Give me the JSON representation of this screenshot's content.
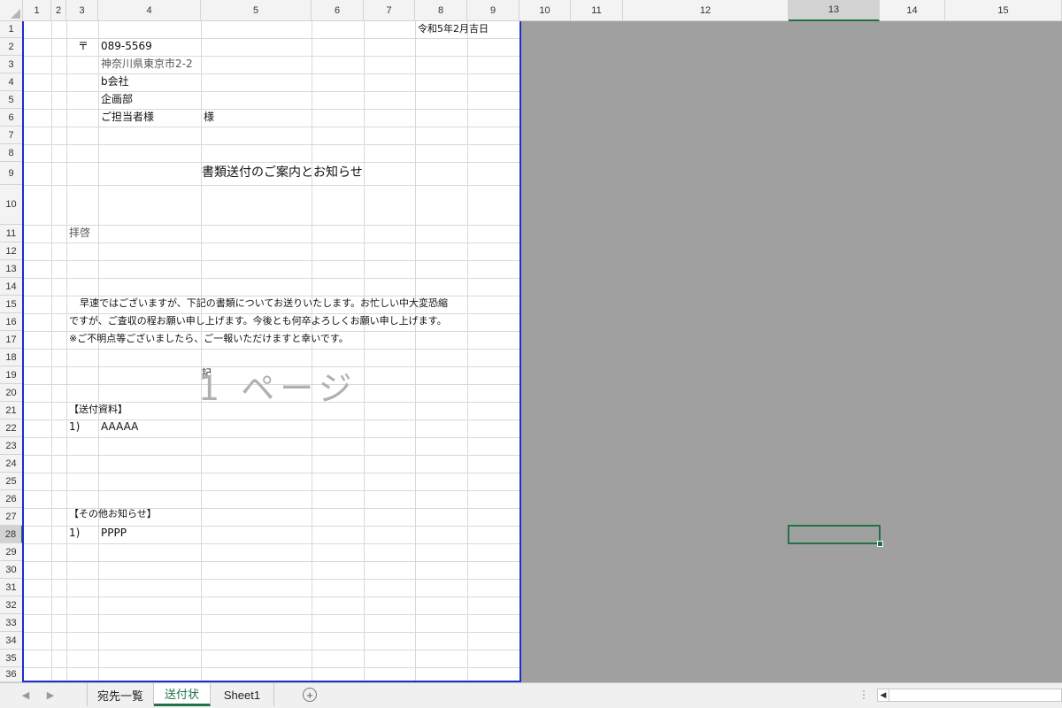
{
  "columns": [
    "1",
    "2",
    "3",
    "4",
    "5",
    "6",
    "7",
    "8",
    "9",
    "10",
    "11",
    "12",
    "13",
    "14",
    "15"
  ],
  "rows": [
    "1",
    "2",
    "3",
    "4",
    "5",
    "6",
    "7",
    "8",
    "9",
    "10",
    "11",
    "12",
    "13",
    "14",
    "15",
    "16",
    "17",
    "18",
    "19",
    "20",
    "21",
    "22",
    "23",
    "24",
    "25",
    "26",
    "27",
    "28",
    "29",
    "30",
    "31",
    "32",
    "33",
    "34",
    "35",
    "36"
  ],
  "selected": {
    "column": "13",
    "row": "28"
  },
  "cells": {
    "date": "令和5年2月吉日",
    "postal_mark": "〒",
    "postal_code": "089-5569",
    "address": "神奈川県東京市2-2",
    "company": "b会社",
    "department": "企画部",
    "recipient": "ご担当者様",
    "honorific": "様",
    "title": "書類送付のご案内とお知らせ",
    "greeting": "拝啓",
    "body_line1": "早速ではございますが、下記の書類についてお送りいたします。お忙しい中大変恐縮",
    "body_line2": "ですが、ご査収の程お願い申し上げます。今後とも何卒よろしくお願い申し上げます。",
    "body_line3": "※ご不明点等ございましたら、ご一報いただけますと幸いです。",
    "ki": "記",
    "section_docs": "【送付資料】",
    "doc_item_no": "1)",
    "doc_item": "AAAAA",
    "section_other": "【その他お知らせ】",
    "other_item_no": "1)",
    "other_item": "PPPP"
  },
  "watermark": "1 ページ",
  "tabs": [
    "宛先一覧",
    "送付状",
    "Sheet1"
  ],
  "active_tab": "送付状",
  "add_sheet_symbol": "+",
  "colors": {
    "accent": "#217346",
    "page_border": "#1f2ecc",
    "outside_page": "#a0a0a0"
  }
}
